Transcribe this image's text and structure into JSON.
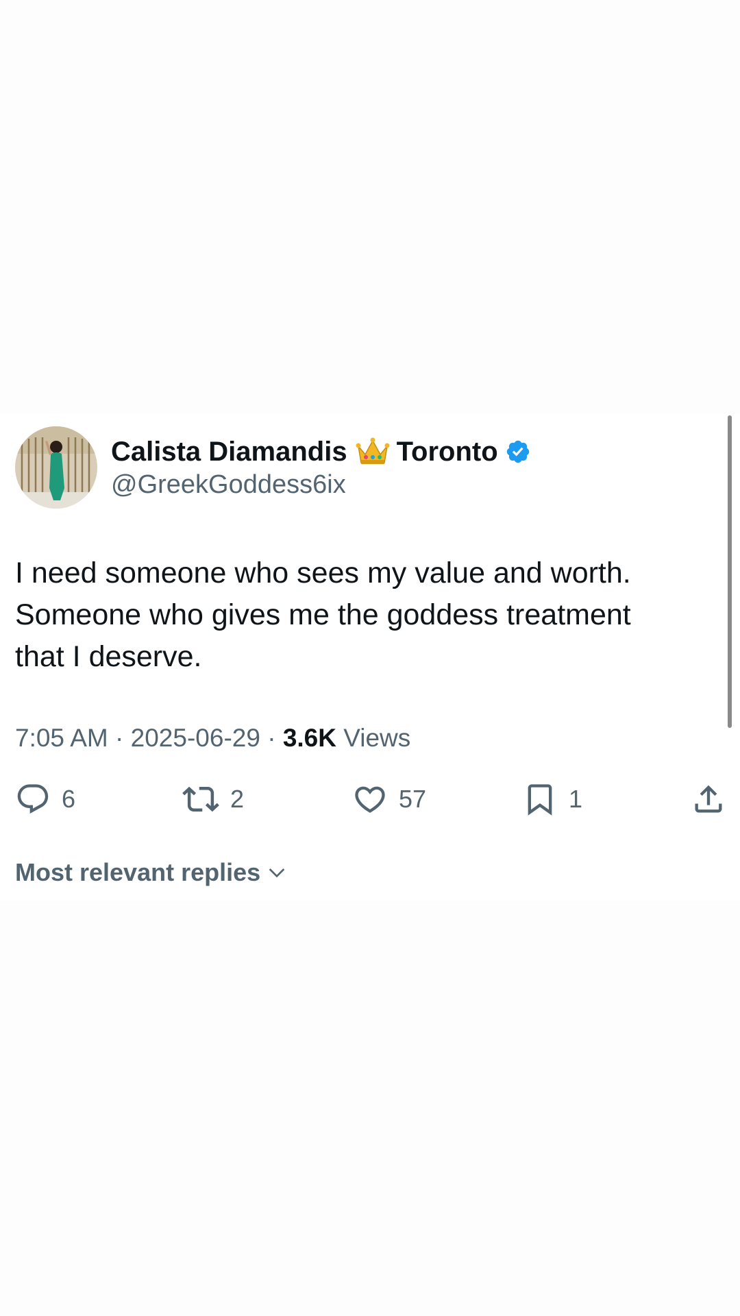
{
  "tweet": {
    "author": {
      "name": "Calista Diamandis",
      "location": "Toronto",
      "handle": "@GreekGoddess6ix",
      "verified": true,
      "crown_icon": "crown-emoji",
      "verified_icon": "verified-badge-icon",
      "verified_color": "#1d9bf0"
    },
    "text_lines": [
      "I need someone who sees my value and worth.",
      "Someone who gives me the goddess treatment",
      "that I deserve."
    ],
    "time": "7:05 AM",
    "date": "2025-06-29",
    "separator": "·",
    "views_count": "3.6K",
    "views_label": "Views"
  },
  "actions": {
    "reply": {
      "icon": "reply-icon",
      "count": "6"
    },
    "retweet": {
      "icon": "retweet-icon",
      "count": "2"
    },
    "like": {
      "icon": "heart-icon",
      "count": "57"
    },
    "bookmark": {
      "icon": "bookmark-icon",
      "count": "1"
    },
    "share": {
      "icon": "share-icon"
    }
  },
  "replies_sort": {
    "label": "Most relevant replies",
    "icon": "chevron-down-icon"
  },
  "colors": {
    "text_primary": "#0f1419",
    "text_secondary": "#536471",
    "background": "#fdfdfd"
  }
}
